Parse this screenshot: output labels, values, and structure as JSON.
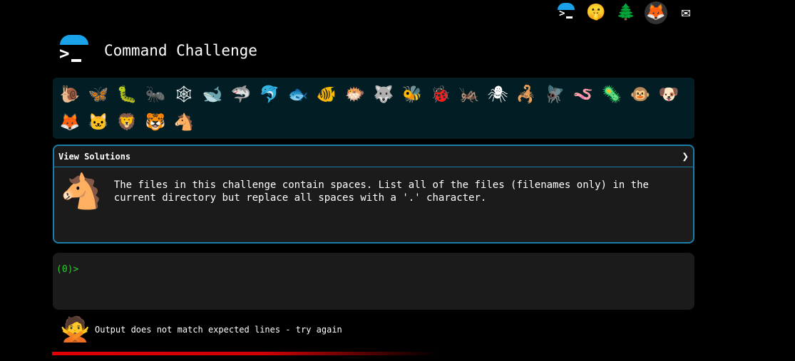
{
  "topbar": {
    "terminal_icon_glyph": ">",
    "shush_icon_glyph": "🤫",
    "tree_icon_glyph": "🌲",
    "gitlab_icon_glyph": "🦊",
    "mail_icon_glyph": "✉"
  },
  "header": {
    "logo_glyph": ">",
    "title": "Command Challenge"
  },
  "animals": [
    {
      "name": "snail",
      "glyph": "🐌"
    },
    {
      "name": "butterfly",
      "glyph": "🦋"
    },
    {
      "name": "caterpillar",
      "glyph": "🐛"
    },
    {
      "name": "ant",
      "glyph": "🐜"
    },
    {
      "name": "spider-web",
      "glyph": "🕸"
    },
    {
      "name": "whale",
      "glyph": "🐋"
    },
    {
      "name": "shark",
      "glyph": "🦈"
    },
    {
      "name": "dolphin",
      "glyph": "🐬"
    },
    {
      "name": "fish",
      "glyph": "🐟"
    },
    {
      "name": "tropical-fish",
      "glyph": "🐠"
    },
    {
      "name": "blowfish",
      "glyph": "🐡"
    },
    {
      "name": "wolf",
      "glyph": "🐺"
    },
    {
      "name": "bee",
      "glyph": "🐝"
    },
    {
      "name": "ladybug",
      "glyph": "🐞"
    },
    {
      "name": "cricket",
      "glyph": "🦗"
    },
    {
      "name": "spider",
      "glyph": "🕷"
    },
    {
      "name": "scorpion",
      "glyph": "🦂"
    },
    {
      "name": "fly",
      "glyph": "🪰"
    },
    {
      "name": "worm",
      "glyph": "🪱"
    },
    {
      "name": "microbe",
      "glyph": "🦠"
    },
    {
      "name": "monkey",
      "glyph": "🐵"
    },
    {
      "name": "dog",
      "glyph": "🐶"
    },
    {
      "name": "fox",
      "glyph": "🦊"
    },
    {
      "name": "cat",
      "glyph": "🐱"
    },
    {
      "name": "lion",
      "glyph": "🦁"
    },
    {
      "name": "tiger",
      "glyph": "🐯"
    },
    {
      "name": "horse",
      "glyph": "🐴"
    }
  ],
  "challenge": {
    "view_solutions_label": "View Solutions",
    "chevron_glyph": "❯",
    "animal_glyph": "🐴",
    "description": "The files in this challenge contain spaces. List all of the files (filenames only) in the current directory but replace all spaces with a '.' character."
  },
  "terminal": {
    "prompt": "(0)>"
  },
  "status": {
    "face_glyph": "🙅",
    "message": "Output does not match expected lines - try again"
  },
  "colors": {
    "accent_blue": "#1aa3e8",
    "border_blue": "#1a7fa8",
    "prompt_green": "#2dcc2d",
    "error_red": "#e00000",
    "animals_bg": "#021e24",
    "panel_bg": "#1b1b1b"
  }
}
